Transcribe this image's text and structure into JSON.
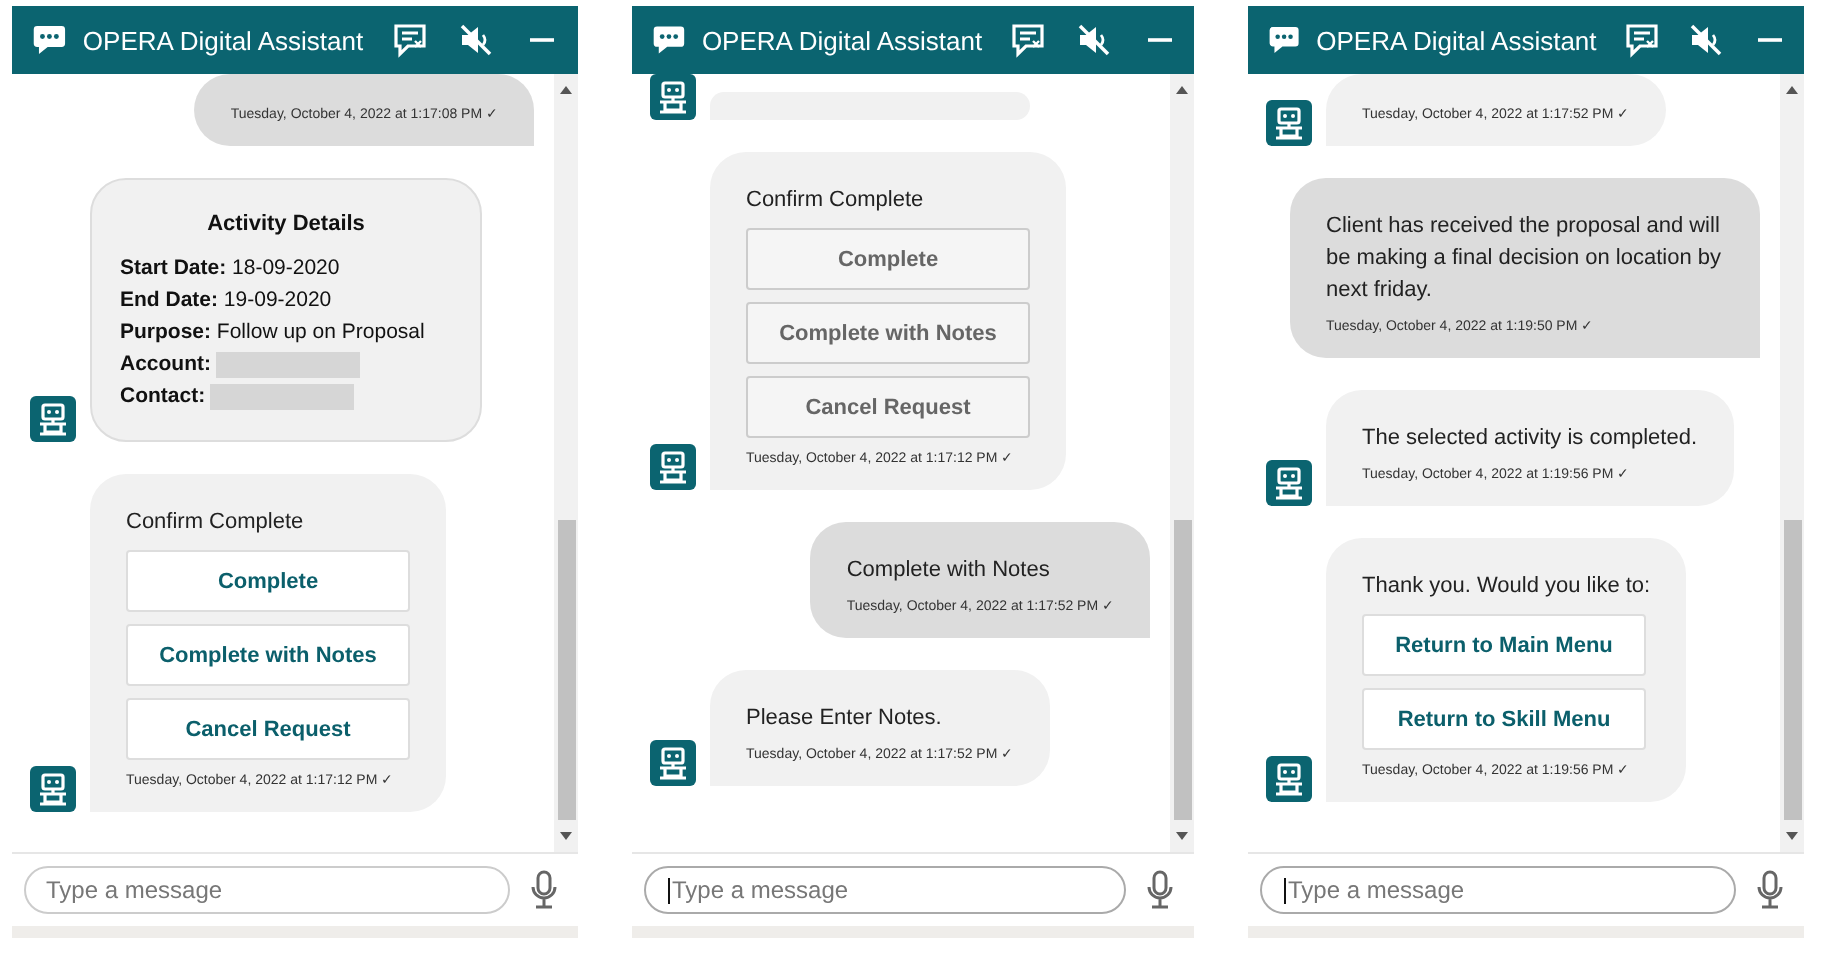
{
  "panels": [
    {
      "title": "OPERA Digital Assistant",
      "messages": [
        {
          "kind": "user",
          "time": "Tuesday, October 4, 2022 at 1:17:08 PM ✓"
        },
        {
          "kind": "details",
          "title": "Activity Details",
          "fields": [
            {
              "line": "**Start Date:** 18-09-2020",
              "redacted": false
            },
            {
              "line": "**End Date:** 19-09-2020",
              "redacted": false
            },
            {
              "line": "**Purpose:** Follow up on Proposal",
              "redacted": false
            },
            {
              "line": "**Account:**",
              "redacted": true
            },
            {
              "line": "**Contact:**",
              "redacted": true
            }
          ]
        },
        {
          "kind": "choices",
          "text": "Confirm Complete",
          "buttons": [
            {
              "label": "Complete",
              "disabled": false
            },
            {
              "label": "Complete with Notes",
              "disabled": false
            },
            {
              "label": "Cancel Request",
              "disabled": false
            }
          ],
          "time": "Tuesday, October 4, 2022 at 1:17:12 PM ✓"
        }
      ],
      "input": {
        "placeholder": "Type a message",
        "focused": false
      }
    },
    {
      "title": "OPERA Digital Assistant",
      "messages": [
        {
          "kind": "bot"
        },
        {
          "kind": "choices",
          "text": "Confirm Complete",
          "buttons": [
            {
              "label": "Complete",
              "disabled": true
            },
            {
              "label": "Complete with Notes",
              "disabled": true
            },
            {
              "label": "Cancel Request",
              "disabled": true
            }
          ],
          "time": "Tuesday, October 4, 2022 at 1:17:12 PM ✓"
        },
        {
          "kind": "user",
          "text": "Complete with Notes",
          "time": "Tuesday, October 4, 2022 at 1:17:52 PM ✓"
        },
        {
          "kind": "bot",
          "text": "Please Enter Notes.",
          "time": "Tuesday, October 4, 2022 at 1:17:52 PM ✓"
        }
      ],
      "input": {
        "placeholder": "Type a message",
        "focused": true
      }
    },
    {
      "title": "OPERA Digital Assistant",
      "messages": [
        {
          "kind": "bot",
          "time": "Tuesday, October 4, 2022 at 1:17:52 PM ✓"
        },
        {
          "kind": "user",
          "text": "Client has received the proposal and will be making a final decision on location by next friday.",
          "time": "Tuesday, October 4, 2022 at 1:19:50 PM ✓"
        },
        {
          "kind": "bot",
          "text": "The selected activity is completed.",
          "time": "Tuesday, October 4, 2022 at 1:19:56 PM ✓"
        },
        {
          "kind": "choices",
          "text": "Thank you. Would you like to:",
          "buttons": [
            {
              "label": "Return to Main Menu",
              "disabled": false
            },
            {
              "label": "Return to Skill Menu",
              "disabled": false
            }
          ],
          "time": "Tuesday, October 4, 2022 at 1:19:56 PM ✓"
        }
      ],
      "input": {
        "placeholder": "Type a message",
        "focused": true
      }
    }
  ]
}
